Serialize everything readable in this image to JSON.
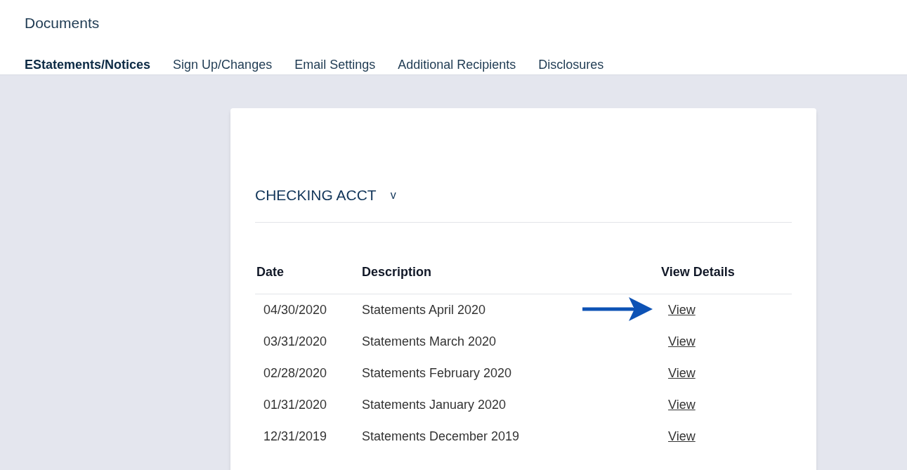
{
  "page_title": "Documents",
  "tabs": [
    {
      "label": "EStatements/Notices",
      "selected": true
    },
    {
      "label": "Sign Up/Changes",
      "selected": false
    },
    {
      "label": "Email Settings",
      "selected": false
    },
    {
      "label": "Additional Recipients",
      "selected": false
    },
    {
      "label": "Disclosures",
      "selected": false
    }
  ],
  "account": {
    "name": "CHECKING ACCT",
    "toggle": "v"
  },
  "table": {
    "columns": [
      "Date",
      "Description",
      "View Details"
    ],
    "rows": [
      {
        "date": "04/30/2020",
        "description": "Statements April 2020",
        "link": "View",
        "pointed": true
      },
      {
        "date": "03/31/2020",
        "description": "Statements March 2020",
        "link": "View",
        "pointed": false
      },
      {
        "date": "02/28/2020",
        "description": "Statements February 2020",
        "link": "View",
        "pointed": false
      },
      {
        "date": "01/31/2020",
        "description": "Statements January 2020",
        "link": "View",
        "pointed": false
      },
      {
        "date": "12/31/2019",
        "description": "Statements December 2019",
        "link": "View",
        "pointed": false
      }
    ]
  }
}
